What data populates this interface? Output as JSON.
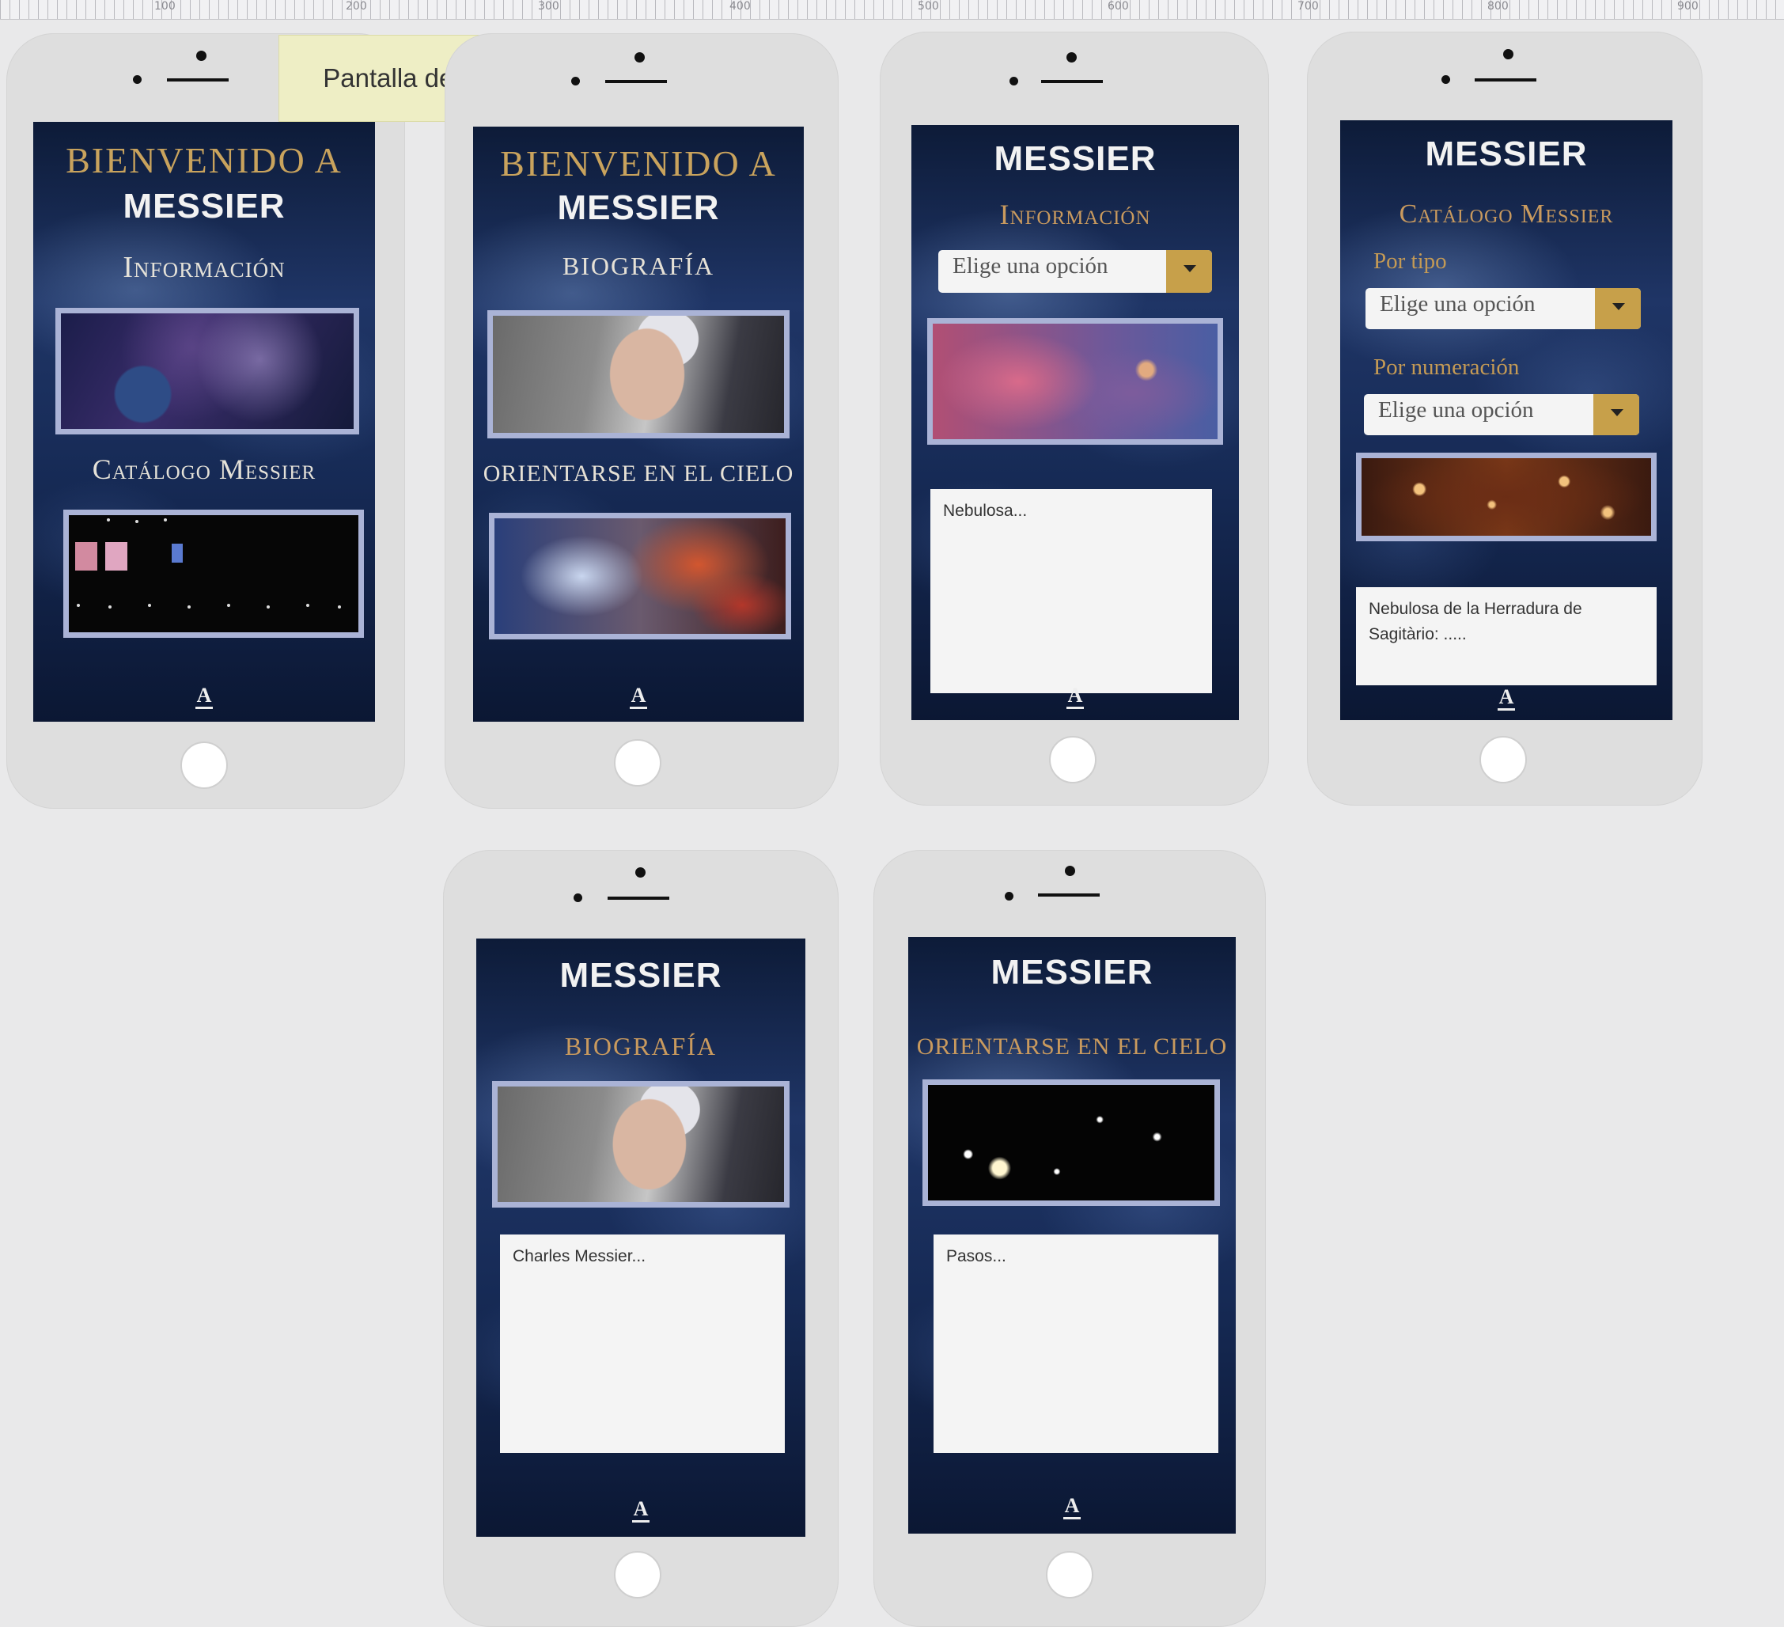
{
  "ruler": {
    "ticks": [
      "100",
      "200",
      "300",
      "400",
      "500",
      "600",
      "700",
      "800",
      "900"
    ]
  },
  "tooltip": {
    "text": "Pantalla de inicio"
  },
  "screens": {
    "home": {
      "title_line1": "BIENVENIDO A",
      "title_line2": "MESSIER",
      "section1": "Información",
      "section2": "Catálogo Messier",
      "logo": "A"
    },
    "home_alt": {
      "title_line1": "BIENVENIDO A",
      "title_line2": "MESSIER",
      "section1": "BIOGRAFÍA",
      "section2": "ORIENTARSE EN EL CIELO",
      "logo": "A"
    },
    "info": {
      "title": "MESSIER",
      "subtitle": "Información",
      "select_value": "Elige una opción",
      "text": "Nebulosa...",
      "logo": "A"
    },
    "catalog": {
      "title": "MESSIER",
      "subtitle": "Catálogo Messier",
      "filter1_label": "Por tipo",
      "filter1_value": "Elige una opción",
      "filter2_label": "Por numeración",
      "filter2_value": "Elige una opción",
      "text": "Nebulosa de la Herradura de Sagitàrio: .....",
      "logo": "A"
    },
    "biography": {
      "title": "MESSIER",
      "subtitle": "BIOGRAFÍA",
      "text": "Charles Messier...",
      "logo": "A"
    },
    "orientation": {
      "title": "MESSIER",
      "subtitle": "ORIENTARSE EN EL CIELO",
      "text": "Pasos...",
      "logo": "A"
    }
  }
}
